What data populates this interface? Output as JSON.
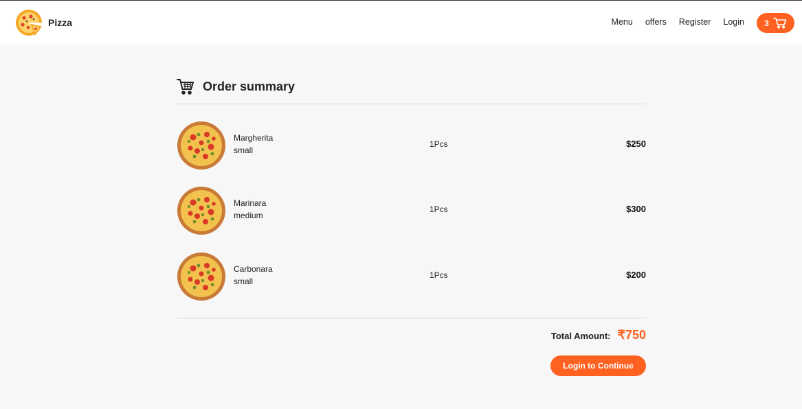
{
  "brand": {
    "name": "Pizza",
    "logo_icon": "pizza-slice-icon"
  },
  "nav": {
    "links": [
      "Menu",
      "offers",
      "Register",
      "Login"
    ]
  },
  "cart": {
    "count": "3",
    "icon": "cart-icon"
  },
  "summary": {
    "title": "Order summary",
    "icon": "cart-icon"
  },
  "items": [
    {
      "name": "Margherita",
      "size": "small",
      "qty": "1Pcs",
      "price": "$250",
      "image_icon": "pizza-icon"
    },
    {
      "name": "Marinara",
      "size": "medium",
      "qty": "1Pcs",
      "price": "$300",
      "image_icon": "pizza-icon"
    },
    {
      "name": "Carbonara",
      "size": "small",
      "qty": "1Pcs",
      "price": "$200",
      "image_icon": "pizza-icon"
    }
  ],
  "total": {
    "label": "Total Amount:",
    "value": "₹750"
  },
  "actions": {
    "login_label": "Login to Continue"
  },
  "colors": {
    "accent": "#ff6120",
    "background": "#f7f7f7",
    "navbar": "#ffffff"
  }
}
